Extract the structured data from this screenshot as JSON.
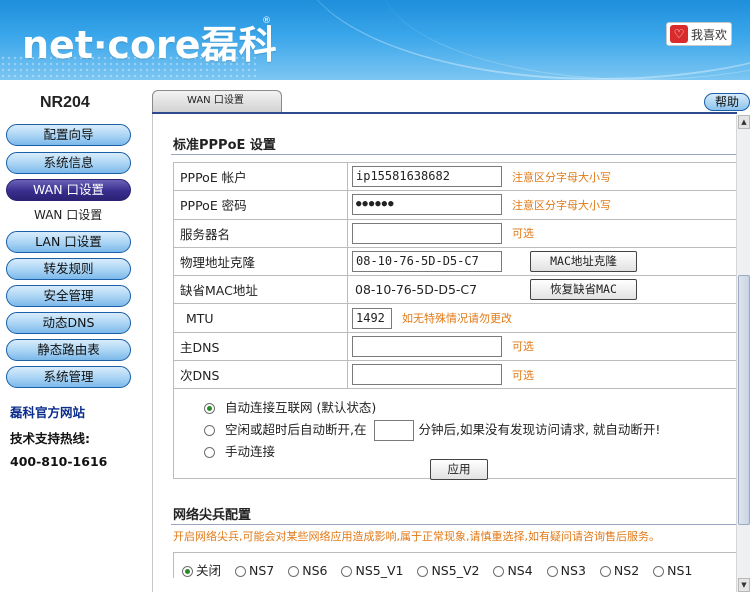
{
  "header": {
    "logo_text": "net·core磊科",
    "logo_reg": "®",
    "fav_icon": "heart-icon",
    "fav_label": "我喜欢"
  },
  "sidebar": {
    "model": "NR204",
    "items": [
      {
        "label": "配置向导"
      },
      {
        "label": "系统信息"
      },
      {
        "label": "WAN 口设置",
        "active": true
      },
      {
        "label": "LAN 口设置"
      },
      {
        "label": "转发规则"
      },
      {
        "label": "安全管理"
      },
      {
        "label": "动态DNS"
      },
      {
        "label": "静态路由表"
      },
      {
        "label": "系统管理"
      }
    ],
    "sub_item": "WAN 口设置",
    "official_site": "磊科官方网站",
    "support_label": "技术支持热线:",
    "support_phone": "400-810-1616"
  },
  "main": {
    "tab_label": "WAN 口设置",
    "help_label": "帮助",
    "pppoe_title": "标准PPPoE 设置",
    "rows": {
      "account_label": "PPPoE 帐户",
      "account_value": "ip15581638682",
      "account_hint": "注意区分字母大小写",
      "password_label": "PPPoE 密码",
      "password_value": "●●●●●●",
      "password_hint": "注意区分字母大小写",
      "server_label": "服务器名",
      "server_value": "",
      "server_hint": "可选",
      "clone_label": "物理地址克隆",
      "clone_value": "08-10-76-5D-D5-C7",
      "clone_button": "MAC地址克隆",
      "default_mac_label": "缺省MAC地址",
      "default_mac_value": "08-10-76-5D-D5-C7",
      "restore_button": "恢复缺省MAC",
      "mtu_label": "MTU",
      "mtu_value": "1492",
      "mtu_hint": "如无特殊情况请勿更改",
      "dns1_label": "主DNS",
      "dns1_value": "",
      "dns1_hint": "可选",
      "dns2_label": "次DNS",
      "dns2_value": "",
      "dns2_hint": "可选"
    },
    "connect_options": {
      "auto": "自动连接互联网 (默认状态)",
      "idle_prefix": "空闲或超时后自动断开,在",
      "idle_value": "",
      "idle_suffix": "分钟后,如果没有发现访问请求, 就自动断开!",
      "manual": "手动连接",
      "selected": "auto"
    },
    "apply_button": "应用",
    "ns_title": "网络尖兵配置",
    "ns_warning": "开启网络尖兵,可能会对某些网络应用造成影响,属于正常现象,请慎重选择,如有疑问请咨询售后服务。",
    "ns_options": [
      "关闭",
      "NS7",
      "NS6",
      "NS5_V1",
      "NS5_V2",
      "NS4",
      "NS3",
      "NS2",
      "NS1"
    ],
    "ns_selected": "关闭"
  }
}
